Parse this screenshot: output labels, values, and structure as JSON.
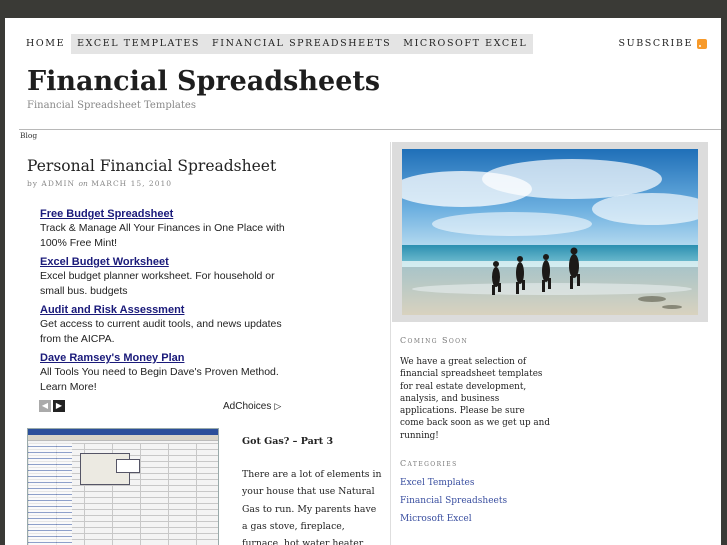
{
  "nav": {
    "items": [
      "HOME",
      "EXCEL TEMPLATES",
      "FINANCIAL SPREADSHEETS",
      "MICROSOFT EXCEL"
    ],
    "subscribe": "SUBSCRIBE"
  },
  "header": {
    "title": "Financial Spreadsheets",
    "tagline": "Financial Spreadsheet Templates"
  },
  "breadcrumb": "Blog",
  "post": {
    "title": "Personal Financial Spreadsheet",
    "meta_by": "by ADMIN",
    "meta_on": "on",
    "meta_date": "MARCH 15, 2010"
  },
  "ads": [
    {
      "title": "Free Budget Spreadsheet",
      "text": "Track & Manage All Your Finances in One Place with 100% Free Mint!"
    },
    {
      "title": "Excel Budget Worksheet",
      "text": "Excel budget planner worksheet. For household or small bus. budgets"
    },
    {
      "title": "Audit and Risk Assessment",
      "text": "Get access to current audit tools, and news updates from the AICPA."
    },
    {
      "title": "Dave Ramsey's Money Plan",
      "text": "All Tools You need to Begin Dave's Proven Method. Learn More!"
    }
  ],
  "adchoices": "AdChoices",
  "post2": {
    "title": "Got Gas? – Part 3",
    "body": "There are a lot of elements in your house that use Natural Gas to run. My parents have a gas stove, fireplace, furnace, hot water heater and a clothes dryer. I"
  },
  "sidebar": {
    "coming_soon_head": "Coming Soon",
    "coming_soon_text": "We have a great selection of financial spreadsheet templates for real estate development, analysis, and business applications. Please be sure come back soon as we get up and running!",
    "categories_head": "Categories",
    "categories": [
      "Excel Templates",
      "Financial Spreadsheets",
      "Microsoft Excel"
    ]
  },
  "colors": {
    "nav_bg": "#e4e4e4",
    "link": "#3a4fa0",
    "ad_title": "#1a1a7a",
    "outer_bg": "#3a3a36"
  }
}
